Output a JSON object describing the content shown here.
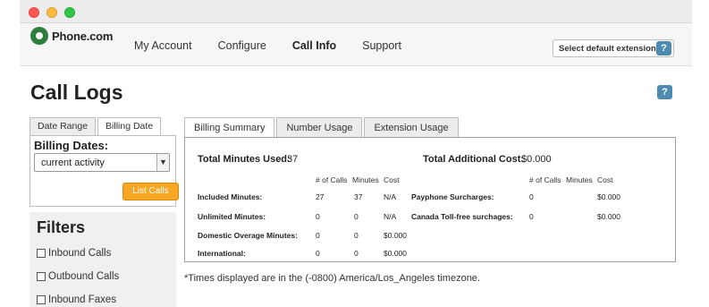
{
  "header": {
    "logo_text": "Phone.com",
    "nav": [
      "My Account",
      "Configure",
      "Call Info",
      "Support"
    ],
    "active_nav": "Call Info",
    "extension_button": "Select default extension",
    "help_glyph": "?"
  },
  "page": {
    "title": "Call Logs"
  },
  "sidebar": {
    "tabs": [
      "Date Range",
      "Billing Date"
    ],
    "active_tab": "Billing Date",
    "billing_label": "Billing Dates:",
    "select_value": "current activity",
    "list_button": "List Calls",
    "filters_title": "Filters",
    "filters": [
      "Inbound Calls",
      "Outbound Calls",
      "Inbound Faxes"
    ]
  },
  "main": {
    "tabs": [
      "Billing Summary",
      "Number Usage",
      "Extension Usage"
    ],
    "active_tab": "Billing Summary",
    "summary": {
      "total_minutes_label": "Total Minutes Used:",
      "total_minutes_value": "37",
      "total_cost_label": "Total Additional Cost:",
      "total_cost_value": "$0.000",
      "columns": [
        "# of Calls",
        "Minutes",
        "Cost"
      ],
      "left_rows": [
        {
          "label": "Included Minutes:",
          "calls": "27",
          "minutes": "37",
          "cost": "N/A"
        },
        {
          "label": "Unlimited Minutes:",
          "calls": "0",
          "minutes": "0",
          "cost": "N/A"
        },
        {
          "label": "Domestic Overage Minutes:",
          "calls": "0",
          "minutes": "0",
          "cost": "$0.000"
        },
        {
          "label": "International:",
          "calls": "0",
          "minutes": "0",
          "cost": "$0.000"
        }
      ],
      "right_rows": [
        {
          "label": "Payphone Surcharges:",
          "calls": "0",
          "minutes": "",
          "cost": "$0.000"
        },
        {
          "label": "Canada Toll-free surchages:",
          "calls": "0",
          "minutes": "",
          "cost": "$0.000"
        }
      ]
    },
    "footnote": "*Times displayed are in the (-0800) America/Los_Angeles timezone."
  }
}
